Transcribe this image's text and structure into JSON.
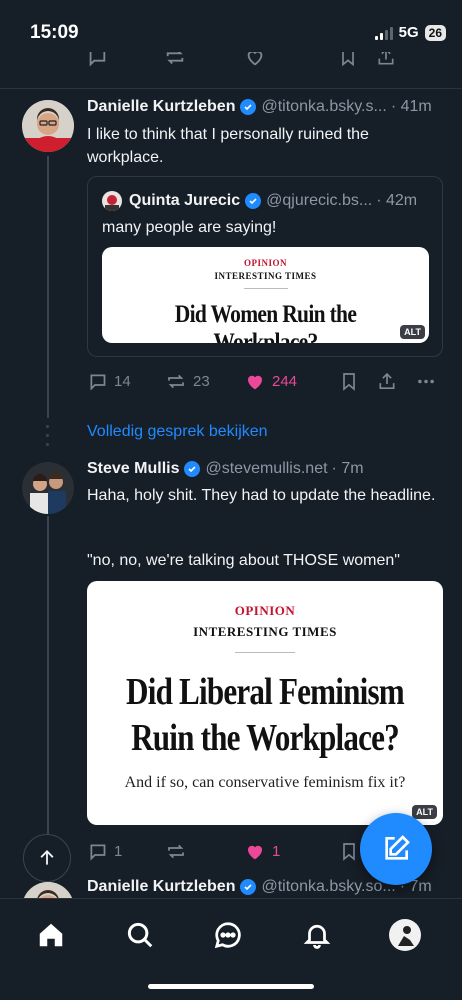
{
  "status": {
    "time": "15:09",
    "network": "5G",
    "battery": "26"
  },
  "posts": [
    {
      "author": "Danielle Kurtzleben",
      "handle": "@titonka.bsky.s...",
      "time": "· 41m",
      "text": "I like to think that I personally ruined the workplace.",
      "quote": {
        "author": "Quinta Jurecic",
        "handle": "@qjurecic.bs...",
        "time": "· 42m",
        "text": "many people are saying!",
        "image": {
          "label": "OPINION",
          "column": "INTERESTING TIMES",
          "headline": "Did Women Ruin the Workplace?",
          "alt_badge": "ALT"
        }
      },
      "actions": {
        "replies": "14",
        "reposts": "23",
        "likes": "244"
      }
    },
    {
      "author": "Steve Mullis",
      "handle": "@stevemullis.net",
      "time": "· 7m",
      "text": "Haha, holy shit. They had to update the headline.",
      "text2": "\"no, no, we're talking about THOSE women\"",
      "image": {
        "label": "OPINION",
        "column": "INTERESTING TIMES",
        "headline_line1": "Did Liberal Feminism",
        "headline_line2": "Ruin the Workplace?",
        "subhead": "And if so, can conservative feminism fix it?",
        "alt_badge": "ALT"
      },
      "actions": {
        "replies": "1",
        "reposts": "",
        "likes": "1"
      }
    },
    {
      "author": "Danielle Kurtzleben",
      "handle": "@titonka.bsky.so...",
      "time": "· 7m"
    }
  ],
  "thread_link": "Volledig gesprek bekijken",
  "nav": [
    "home-icon",
    "search-icon",
    "chat-icon",
    "bell-icon",
    "profile-avatar"
  ],
  "colors": {
    "background": "#161e27",
    "accent": "#208bfe",
    "like": "#ec4899",
    "muted": "#8b98a5"
  }
}
